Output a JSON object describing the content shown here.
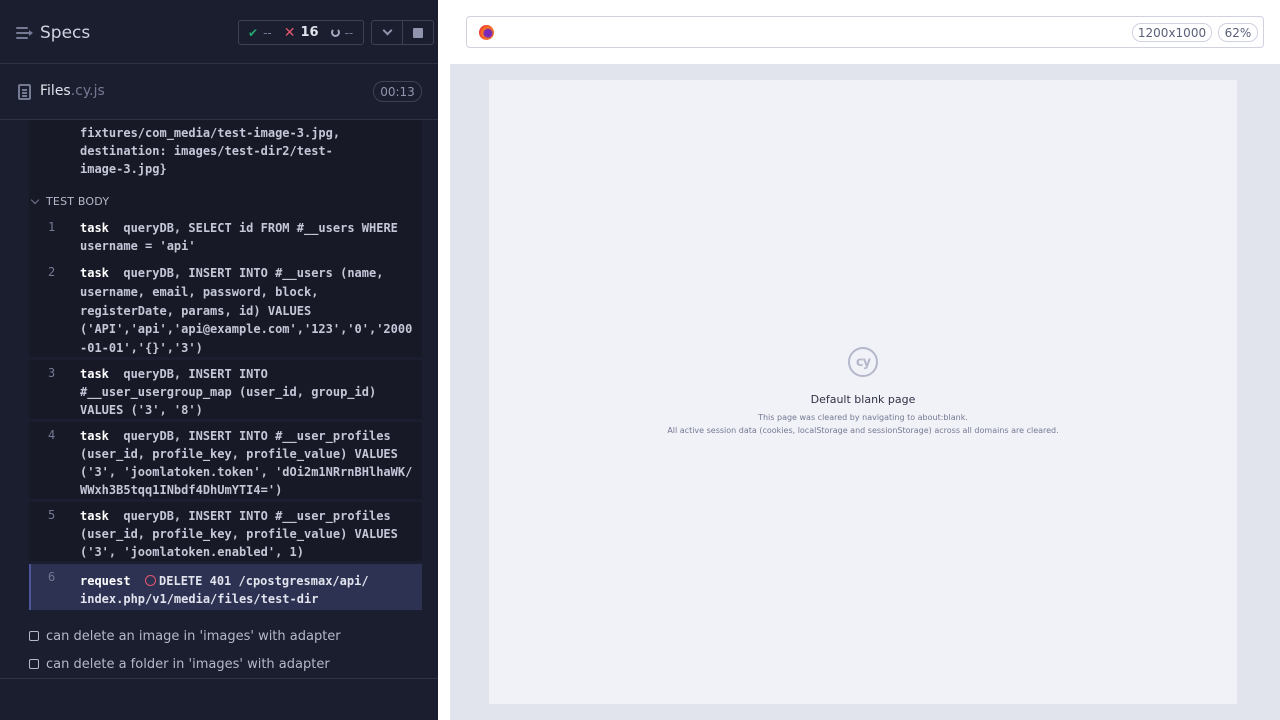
{
  "header": {
    "specs_label": "Specs",
    "stats": {
      "passed": "--",
      "failed": "16",
      "pending": "--"
    }
  },
  "file": {
    "name": "Files",
    "ext": ".cy.js",
    "duration": "00:13"
  },
  "hook": {
    "lines": [
      "fixtures/com_media/test-image-3.jpg,",
      "destination: images/test-dir2/test-",
      "image-3.jpg}"
    ]
  },
  "test_body": {
    "label": "TEST BODY",
    "commands": [
      {
        "num": "1",
        "name": "task",
        "first": "queryDB, SELECT id FROM #__users WHERE",
        "lines": [
          "username = 'api'"
        ]
      },
      {
        "num": "2",
        "name": "task",
        "first": "queryDB, INSERT INTO #__users (name,",
        "lines": [
          "username, email, password, block,",
          "registerDate, params, id) VALUES",
          "('API','api','api@example.com','123','0','2000",
          "-01-01','{}','3')"
        ]
      },
      {
        "num": "3",
        "name": "task",
        "first": "queryDB, INSERT INTO",
        "lines": [
          "#__user_usergroup_map (user_id, group_id)",
          "VALUES ('3', '8')"
        ]
      },
      {
        "num": "4",
        "name": "task",
        "first": "queryDB, INSERT INTO #__user_profiles",
        "lines": [
          "(user_id, profile_key, profile_value) VALUES",
          "('3', 'joomlatoken.token', 'dOi2m1NRrnBHlhaWK/",
          "WWxh3B5tqq1INbdf4DhUmYTI4=')"
        ]
      },
      {
        "num": "5",
        "name": "task",
        "first": "queryDB, INSERT INTO #__user_profiles",
        "lines": [
          "(user_id, profile_key, profile_value) VALUES",
          "('3', 'joomlatoken.enabled', 1)"
        ]
      },
      {
        "num": "6",
        "name": "request",
        "first": "DELETE 401 /cpostgresmax/api/",
        "lines": [
          "index.php/v1/media/files/test-dir"
        ]
      }
    ]
  },
  "tests": [
    {
      "title": "can delete an image in 'images' with adapter"
    },
    {
      "title": "can delete a folder in 'images' with adapter"
    }
  ],
  "preview": {
    "viewport_size": "1200x1000",
    "zoom": "62%",
    "logo_text": "cy",
    "blank_title": "Default blank page",
    "blank_line1": "This page was cleared by navigating to about:blank.",
    "blank_line2": "All active session data (cookies, localStorage and sessionStorage) across all domains are cleared."
  },
  "icons": {
    "specs": "menu-icon",
    "passed": "check-icon",
    "failed": "x-icon",
    "pending": "spinner-icon",
    "file": "file-icon",
    "collapse": "chevron-down-icon",
    "stop": "stop-icon",
    "browser": "firefox-icon",
    "failed_request": "fail-ring-icon",
    "test_status": "checkbox-icon"
  },
  "colors": {
    "panel_bg": "#1b1e2e",
    "fail": "#e45770",
    "pass": "#1fa971",
    "active_command": "#2d3152"
  }
}
